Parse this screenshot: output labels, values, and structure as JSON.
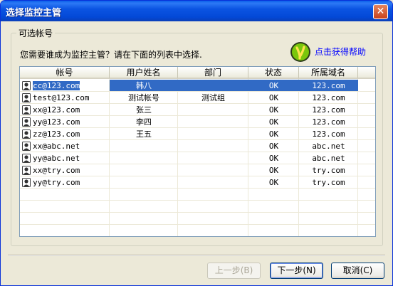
{
  "window": {
    "title": "选择监控主管",
    "close_symbol": "✕"
  },
  "group": {
    "label": "可选帐号"
  },
  "instruction": "您需要谁成为监控主管？请在下面的列表中选择.",
  "help": {
    "label": "点击获得帮助",
    "icon": "help-icon"
  },
  "table": {
    "columns": [
      "帐号",
      "用户姓名",
      "部门",
      "状态",
      "所属域名"
    ],
    "rows": [
      {
        "account": "cc@123.com",
        "name": "韩八",
        "dept": "",
        "status": "OK",
        "domain": "123.com",
        "selected": true
      },
      {
        "account": "test@123.com",
        "name": "测试帐号",
        "dept": "测试组",
        "status": "OK",
        "domain": "123.com"
      },
      {
        "account": "xx@123.com",
        "name": "张三",
        "dept": "",
        "status": "OK",
        "domain": "123.com"
      },
      {
        "account": "yy@123.com",
        "name": "李四",
        "dept": "",
        "status": "OK",
        "domain": "123.com"
      },
      {
        "account": "zz@123.com",
        "name": "王五",
        "dept": "",
        "status": "OK",
        "domain": "123.com"
      },
      {
        "account": "xx@abc.net",
        "name": "",
        "dept": "",
        "status": "OK",
        "domain": "abc.net"
      },
      {
        "account": "yy@abc.net",
        "name": "",
        "dept": "",
        "status": "OK",
        "domain": "abc.net"
      },
      {
        "account": "xx@try.com",
        "name": "",
        "dept": "",
        "status": "OK",
        "domain": "try.com"
      },
      {
        "account": "yy@try.com",
        "name": "",
        "dept": "",
        "status": "OK",
        "domain": "try.com"
      }
    ]
  },
  "buttons": {
    "prev": "上一步(B)",
    "next": "下一步(N)",
    "cancel": "取消(C)"
  },
  "colors": {
    "selection": "#316ac5",
    "title_bar": "#0348d6",
    "link": "#0000ff"
  }
}
